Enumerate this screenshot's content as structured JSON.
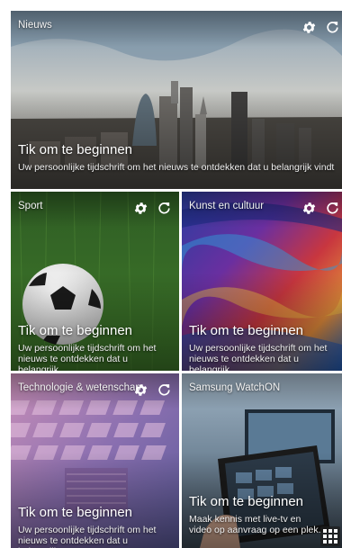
{
  "tiles": {
    "news": {
      "title": "Nieuws",
      "cta": "Tik om te beginnen",
      "description": "Uw persoonlijke tijdschrift om het nieuws te ontdekken dat u belangrijk vindt"
    },
    "sport": {
      "title": "Sport",
      "cta": "Tik om te beginnen",
      "description": "Uw persoonlijke tijdschrift om het nieuws te ontdekken dat u belangrijk..."
    },
    "kunst": {
      "title": "Kunst en cultuur",
      "cta": "Tik om te beginnen",
      "description": "Uw persoonlijke tijdschrift om het nieuws te ontdekken dat u belangrijk..."
    },
    "tech": {
      "title": "Technologie & wetenschap",
      "cta": "Tik om te beginnen",
      "description": "Uw persoonlijke tijdschrift om het nieuws te ontdekken dat u belangrijk..."
    },
    "watch": {
      "title": "Samsung WatchON",
      "cta": "Tik om te beginnen",
      "description": "Maak kennis met live-tv en video op aanvraag op een plek."
    }
  },
  "icons": {
    "settings": "gear-icon",
    "refresh": "refresh-icon",
    "apps": "grid-icon"
  }
}
